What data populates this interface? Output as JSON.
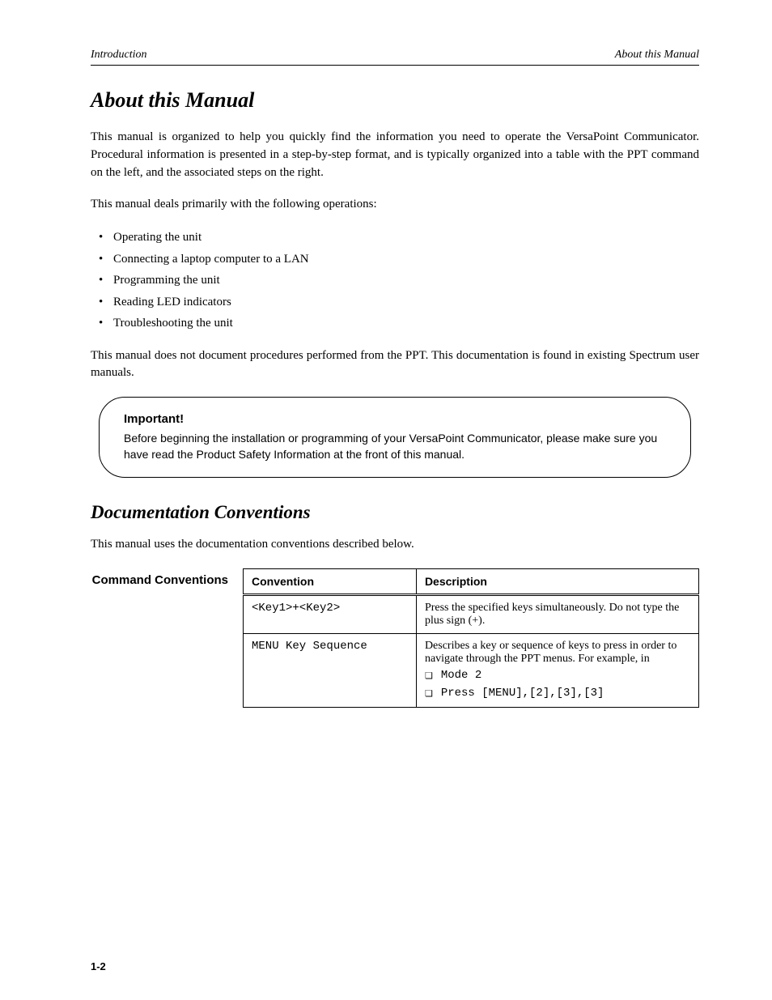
{
  "header": {
    "left": "Introduction",
    "right": "About this Manual"
  },
  "section": {
    "title": "About this Manual",
    "p1": "This manual is organized to help you quickly find the information you need to operate the VersaPoint Communicator. Procedural information is presented in a step-by-step format, and is typically organized into a table with the PPT command on the left, and the associated steps on the right.",
    "p2": "This manual deals primarily with the following operations:",
    "bullets": [
      "Operating the unit",
      "Connecting a laptop computer to a LAN",
      "Programming the unit",
      "Reading LED indicators",
      "Troubleshooting the unit"
    ],
    "p3": "This manual does not document procedures performed from the PPT. This documentation is found in existing Spectrum user manuals."
  },
  "callout": {
    "title": "Important!",
    "text": "Before beginning the installation or programming of your VersaPoint Communicator, please make sure you have read the Product Safety Information at the front of this manual."
  },
  "conventions": {
    "title": "Documentation Conventions",
    "intro": "This manual uses the documentation conventions described below.",
    "block_label": "Command Conventions",
    "table": {
      "head": [
        "Convention",
        "Description"
      ],
      "rows": [
        {
          "conv": "<Key1>+<Key2>",
          "desc": "Press the specified keys simultaneously. Do not type the plus sign (+)."
        },
        {
          "conv": "MENU Key Sequence",
          "desc": "Describes a key or sequence of keys to press in order to navigate through the PPT menus. For example, in",
          "notes": [
            "Mode 2",
            "Press [MENU],[2],[3],[3]"
          ]
        }
      ]
    }
  },
  "footer": "1-2"
}
